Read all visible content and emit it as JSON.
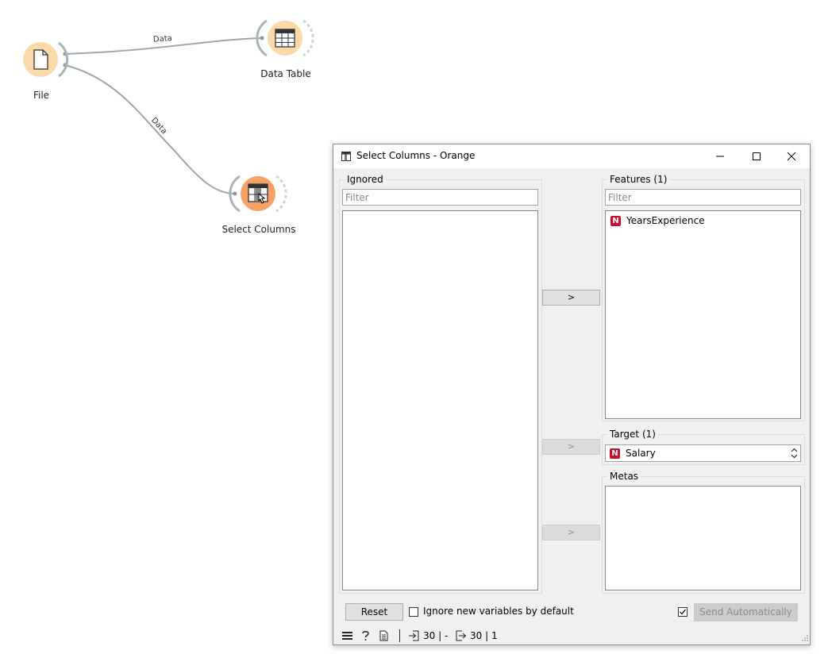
{
  "workflow": {
    "nodes": [
      {
        "label": "File",
        "icon": "file-icon"
      },
      {
        "label": "Data Table",
        "icon": "table-icon"
      },
      {
        "label": "Select Columns",
        "icon": "select-columns-icon"
      }
    ],
    "links": [
      {
        "from": "File",
        "to": "Data Table",
        "label": "Data"
      },
      {
        "from": "File",
        "to": "Select Columns",
        "label": "Data"
      }
    ]
  },
  "window": {
    "title": "Select Columns - Orange",
    "controls": [
      "minimize",
      "maximize",
      "close"
    ]
  },
  "ignored": {
    "title": "Ignored",
    "filter_placeholder": "Filter",
    "items": []
  },
  "features": {
    "title": "Features (1)",
    "filter_placeholder": "Filter",
    "items": [
      {
        "name": "YearsExperience",
        "type": "N"
      }
    ]
  },
  "target": {
    "title": "Target (1)",
    "selected": {
      "name": "Salary",
      "type": "N"
    }
  },
  "metas": {
    "title": "Metas",
    "items": []
  },
  "move_buttons": {
    "features": ">",
    "target": ">",
    "metas": ">"
  },
  "footer": {
    "reset_label": "Reset",
    "ignore_new_label": "Ignore new variables by default",
    "ignore_new_checked": false,
    "send_auto_label": "Send Automatically",
    "send_auto_checked": true
  },
  "status_bar": {
    "input_summary": "30 | -",
    "output_summary": "30 | 1"
  },
  "colors": {
    "node_fill": "#fbd9a8",
    "node_selected_fill": "#f6a267",
    "numeric_badge": "#c8102e",
    "link": "#9aa7ac"
  }
}
